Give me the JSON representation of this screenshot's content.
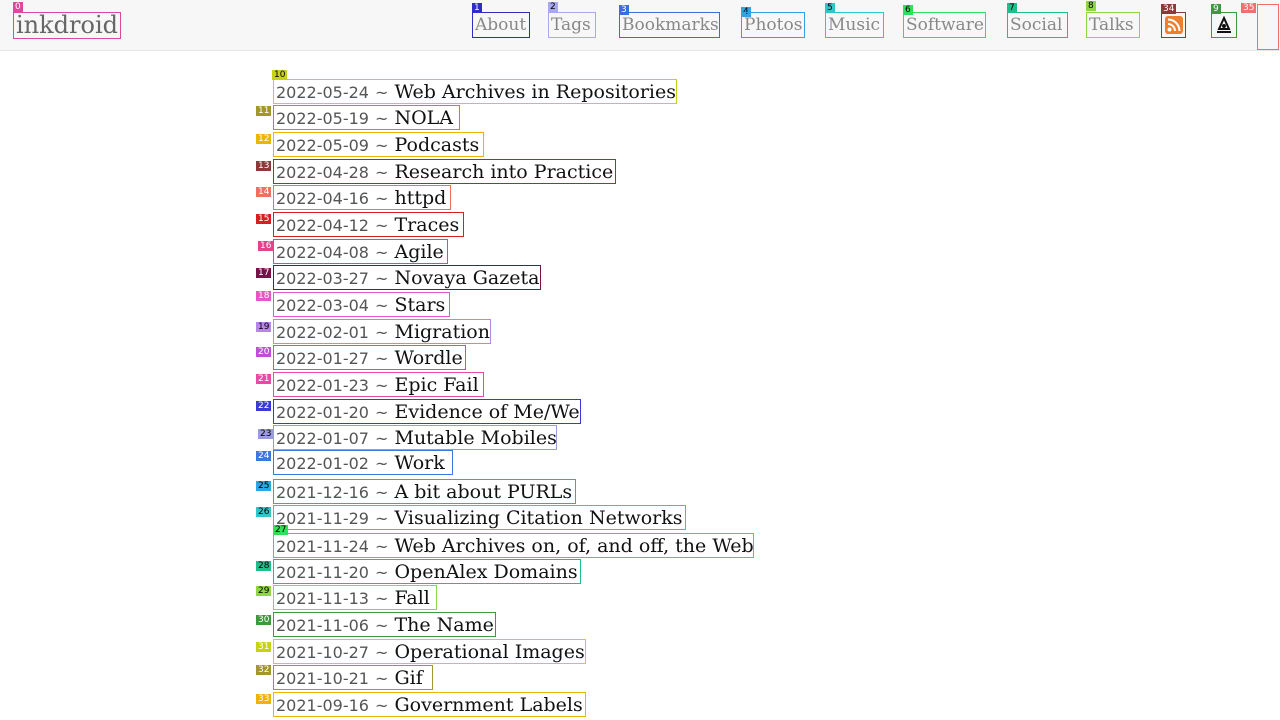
{
  "header": {
    "brand": "inkdroid",
    "nav": [
      "About",
      "Tags",
      "Bookmarks",
      "Photos",
      "Music",
      "Software",
      "Social",
      "Talks"
    ],
    "feed_icon": "rss-icon",
    "misc_icon": "pen-logo-icon"
  },
  "marks": {
    "brand": "0",
    "nav": [
      "1",
      "2",
      "3",
      "4",
      "5",
      "6",
      "7",
      "8"
    ],
    "misc": "9",
    "feed": "34",
    "blank": "35",
    "posts": [
      "10",
      "11",
      "12",
      "13",
      "14",
      "15",
      "16",
      "17",
      "18",
      "19",
      "20",
      "21",
      "22",
      "23",
      "24",
      "25",
      "26",
      "27",
      "28",
      "29",
      "30",
      "31",
      "32",
      "33"
    ]
  },
  "posts": [
    {
      "date": "2022-05-24",
      "title": "Web Archives in Repositories"
    },
    {
      "date": "2022-05-19",
      "title": "NOLA"
    },
    {
      "date": "2022-05-09",
      "title": "Podcasts"
    },
    {
      "date": "2022-04-28",
      "title": "Research into Practice"
    },
    {
      "date": "2022-04-16",
      "title": "httpd"
    },
    {
      "date": "2022-04-12",
      "title": "Traces"
    },
    {
      "date": "2022-04-08",
      "title": "Agile"
    },
    {
      "date": "2022-03-27",
      "title": "Novaya Gazeta"
    },
    {
      "date": "2022-03-04",
      "title": "Stars"
    },
    {
      "date": "2022-02-01",
      "title": "Migration"
    },
    {
      "date": "2022-01-27",
      "title": "Wordle"
    },
    {
      "date": "2022-01-23",
      "title": "Epic Fail"
    },
    {
      "date": "2022-01-20",
      "title": "Evidence of Me/We"
    },
    {
      "date": "2022-01-07",
      "title": "Mutable Mobiles"
    },
    {
      "date": "2022-01-02",
      "title": "Work"
    },
    {
      "date": "2021-12-16",
      "title": "A bit about PURLs"
    },
    {
      "date": "2021-11-29",
      "title": "Visualizing Citation Networks"
    },
    {
      "date": "2021-11-24",
      "title": "Web Archives on, of, and off, the Web"
    },
    {
      "date": "2021-11-20",
      "title": "OpenAlex Domains"
    },
    {
      "date": "2021-11-13",
      "title": "Fall"
    },
    {
      "date": "2021-11-06",
      "title": "The Name"
    },
    {
      "date": "2021-10-27",
      "title": "Operational Images"
    },
    {
      "date": "2021-10-21",
      "title": "Gif"
    },
    {
      "date": "2021-09-16",
      "title": "Government Labels"
    }
  ],
  "separator": "~"
}
